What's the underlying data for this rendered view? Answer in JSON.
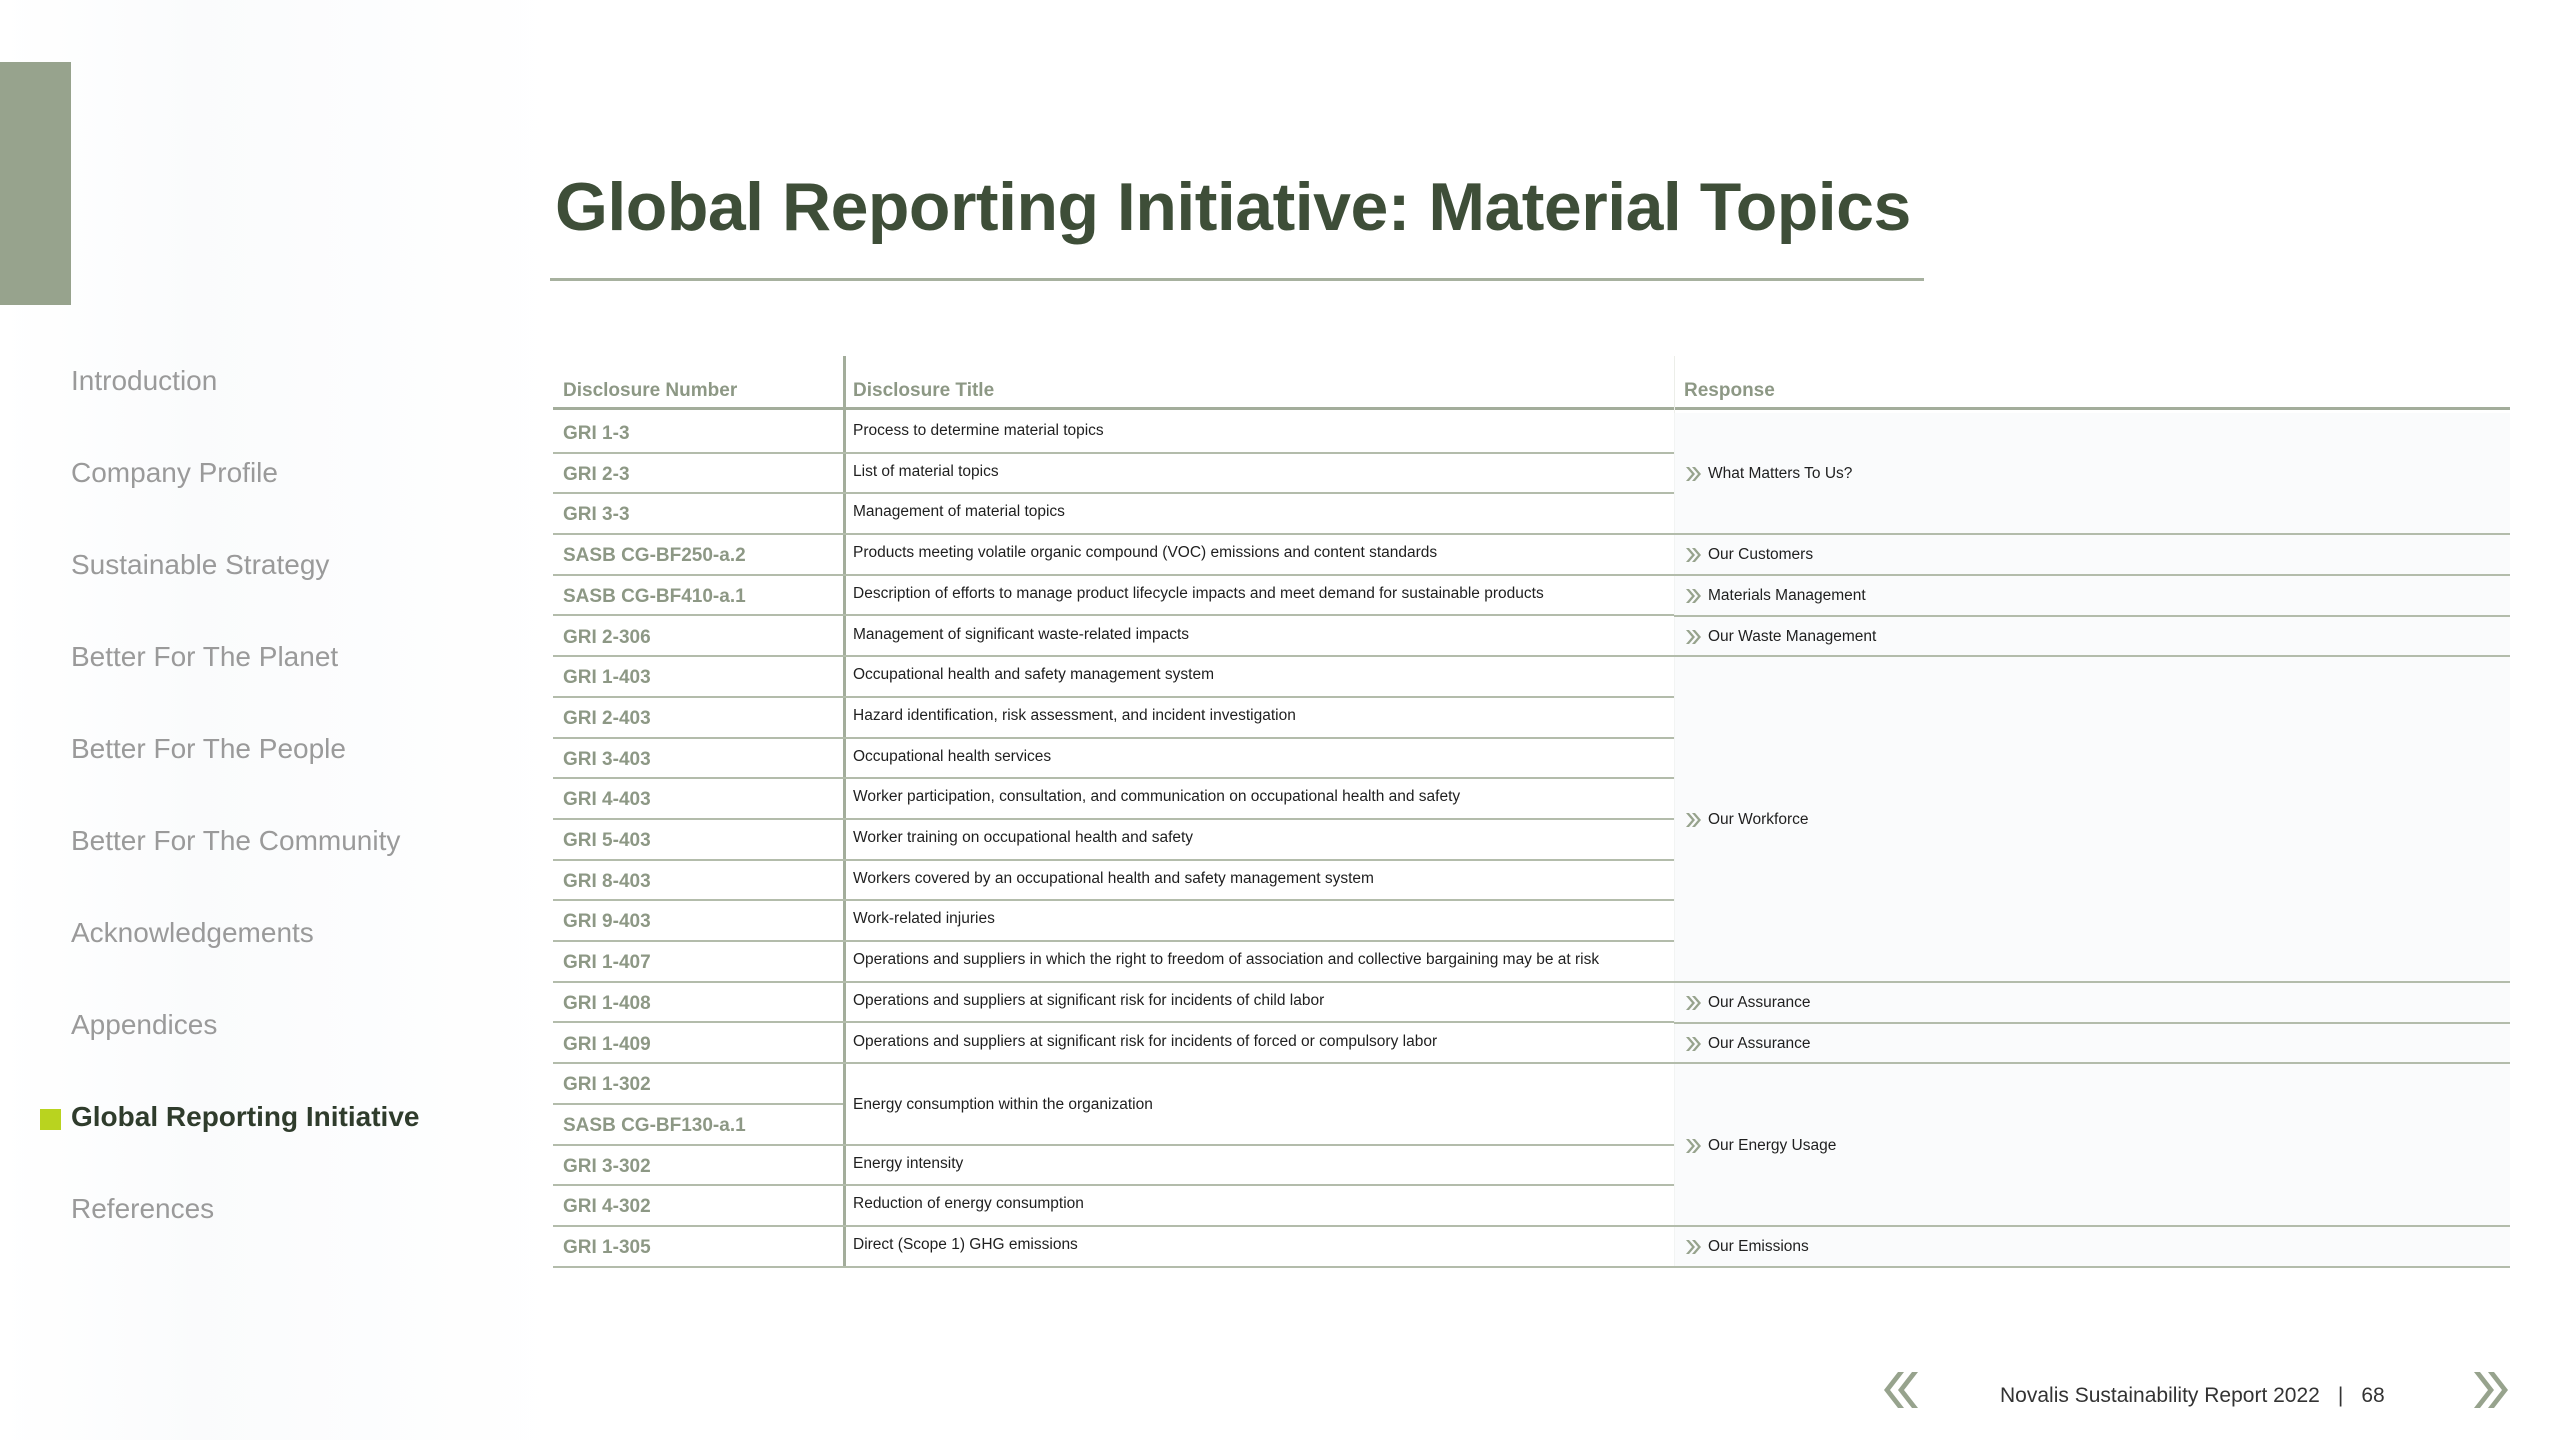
{
  "page": {
    "title": "Global Reporting Initiative: Material Topics",
    "colors": {
      "accent": "#97a38d",
      "title": "#3e4e38",
      "active_marker": "#b9d31f",
      "nav_text": "#9a9a9a",
      "header_text": "#8d9885"
    }
  },
  "nav": {
    "items": [
      {
        "label": "Introduction",
        "active": false
      },
      {
        "label": "Company Profile",
        "active": false
      },
      {
        "label": "Sustainable Strategy",
        "active": false
      },
      {
        "label": "Better For The Planet",
        "active": false
      },
      {
        "label": "Better For The People",
        "active": false
      },
      {
        "label": "Better For The Community",
        "active": false
      },
      {
        "label": "Acknowledgements",
        "active": false
      },
      {
        "label": "Appendices",
        "active": false
      },
      {
        "label": "Global Reporting Initiative",
        "active": true
      },
      {
        "label": "References",
        "active": false
      }
    ]
  },
  "table": {
    "headers": {
      "number": "Disclosure Number",
      "title": "Disclosure Title",
      "response": "Response"
    },
    "rows": [
      {
        "number": "GRI 1-3",
        "title": "Process to determine material topics"
      },
      {
        "number": "GRI 2-3",
        "title": "List of material topics"
      },
      {
        "number": "GRI 3-3",
        "title": "Management of material topics"
      },
      {
        "number": "SASB CG-BF250-a.2",
        "title": "Products meeting volatile organic compound (VOC) emissions and content standards"
      },
      {
        "number": "SASB CG-BF410-a.1",
        "title": "Description of efforts to manage product lifecycle impacts and meet demand for sustainable products"
      },
      {
        "number": "GRI 2-306",
        "title": "Management of significant waste-related impacts"
      },
      {
        "number": "GRI 1-403",
        "title": "Occupational health and safety management system"
      },
      {
        "number": "GRI 2-403",
        "title": "Hazard identification, risk assessment, and incident investigation"
      },
      {
        "number": "GRI 3-403",
        "title": "Occupational health services"
      },
      {
        "number": "GRI 4-403",
        "title": "Worker participation, consultation, and communication on occupational health and safety"
      },
      {
        "number": "GRI 5-403",
        "title": "Worker training on occupational health and safety"
      },
      {
        "number": "GRI 8-403",
        "title": "Workers covered by an occupational health and safety management system"
      },
      {
        "number": "GRI 9-403",
        "title": "Work-related injuries"
      },
      {
        "number": "GRI 1-407",
        "title": "Operations and suppliers in which the right to freedom of association and collective bargaining may be at risk"
      },
      {
        "number": "GRI 1-408",
        "title": "Operations and suppliers at significant risk for incidents of child labor"
      },
      {
        "number": "GRI 1-409",
        "title": "Operations and suppliers at significant risk for incidents of forced or compulsory labor"
      },
      {
        "number": "GRI 1-302",
        "title": ""
      },
      {
        "number": "SASB CG-BF130-a.1",
        "title": ""
      },
      {
        "number": "GRI 3-302",
        "title": "Energy intensity"
      },
      {
        "number": "GRI 4-302",
        "title": "Reduction of energy consumption"
      },
      {
        "number": "GRI 1-305",
        "title": "Direct (Scope 1) GHG emissions"
      }
    ],
    "merged_title": "Energy consumption within the organization",
    "responses": [
      "What Matters To Us?",
      "Our Customers",
      "Materials Management",
      "Our Waste Management",
      "Our Workforce",
      "Our Assurance",
      "Our Assurance",
      "Our Energy Usage",
      "Our Emissions"
    ]
  },
  "footer": {
    "report": "Novalis Sustainability Report 2022",
    "separator": "|",
    "page_number": "68"
  }
}
